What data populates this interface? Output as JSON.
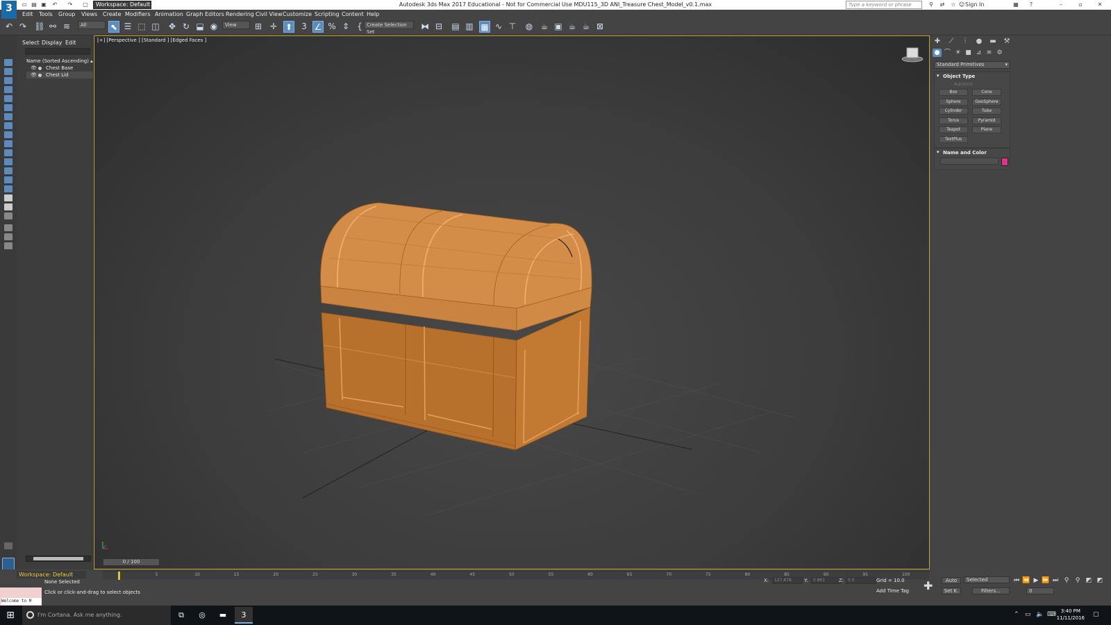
{
  "titlebar": {
    "title": "Autodesk 3ds Max 2017 Educational - Not for Commercial Use     MDU115_3D ANI_Treasure Chest_Model_v0.1.max",
    "workspace": "Workspace: Default",
    "search_placeholder": "Type a keyword or phrase",
    "sign_in": "Sign In",
    "logo": "3"
  },
  "menu": [
    "Edit",
    "Tools",
    "Group",
    "Views",
    "Create",
    "Modifiers",
    "Animation",
    "Graph Editors",
    "Rendering",
    "Civil View",
    "Customize",
    "Scripting",
    "Content",
    "Help"
  ],
  "toolbar": {
    "filter_value": "All",
    "refcoord_value": "View",
    "selection_set": "Create Selection Set"
  },
  "explorer": {
    "tabs": [
      "Select",
      "Display",
      "Edit"
    ],
    "column_header": "Name (Sorted Ascending) ▴ Froz",
    "items": [
      {
        "name": "Chest Base"
      },
      {
        "name": "Chest Lid"
      }
    ]
  },
  "viewport": {
    "label": "[+] [Perspective ] [Standard ] [Edged Faces ]"
  },
  "command_panel": {
    "category": "Standard Primitives",
    "object_type_title": "Object Type",
    "autogrid": "AutoGrid",
    "primitives": [
      "Box",
      "Cone",
      "Sphere",
      "GeoSphere",
      "Cylinder",
      "Tube",
      "Torus",
      "Pyramid",
      "Teapot",
      "Plane",
      "TextPlus"
    ],
    "name_color_title": "Name and Color",
    "color": "#e0328c"
  },
  "timeline": {
    "frame": "0 / 100",
    "ticks": [
      "5",
      "10",
      "15",
      "20",
      "25",
      "30",
      "35",
      "40",
      "45",
      "50",
      "55",
      "60",
      "65",
      "70",
      "75",
      "80",
      "85",
      "90",
      "95",
      "100"
    ]
  },
  "status": {
    "workspace": "Workspace: Default",
    "selection": "None Selected",
    "prompt": "Click or click-and-drag to select objects",
    "maxscript": "Welcome to M",
    "x_label": "X:",
    "x_value": "127.878",
    "y_label": "Y:",
    "y_value": "0.861",
    "z_label": "Z:",
    "z_value": "0.0",
    "grid": "Grid = 10.0",
    "add_time_tag": "Add Time Tag",
    "auto": "Auto",
    "set_k": "Set K.",
    "selected": "Selected",
    "filters": "Filters...",
    "frame_field": "0"
  },
  "taskbar": {
    "cortana": "I'm Cortana. Ask me anything.",
    "time": "3:40 PM",
    "date": "11/11/2016"
  },
  "colors": {
    "chest_light": "#d8914a",
    "chest_mid": "#c27a33",
    "chest_dark": "#9a5a1f",
    "viewport_border": "#c9a63a",
    "accent": "#5b8dbf"
  }
}
